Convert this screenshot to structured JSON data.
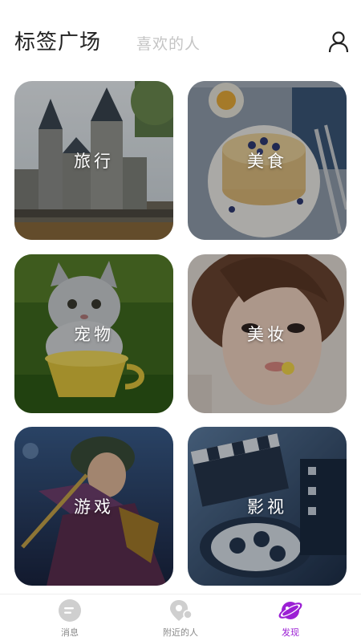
{
  "header": {
    "title": "标签广场",
    "secondary_tab": "喜欢的人",
    "profile_icon": "user-icon"
  },
  "categories": [
    {
      "label": "旅行"
    },
    {
      "label": "美食"
    },
    {
      "label": "宠物"
    },
    {
      "label": "美妆"
    },
    {
      "label": "游戏"
    },
    {
      "label": "影视"
    }
  ],
  "bottom_nav": {
    "items": [
      {
        "label": "消息",
        "icon": "message-icon",
        "active": false
      },
      {
        "label": "附近的人",
        "icon": "location-pin-icon",
        "active": false
      },
      {
        "label": "发现",
        "icon": "planet-icon",
        "active": true
      }
    ]
  },
  "colors": {
    "accent": "#9b1fd4",
    "inactive_icon": "#cfcfcf",
    "title": "#222222",
    "subtab": "#c4c4c4"
  }
}
